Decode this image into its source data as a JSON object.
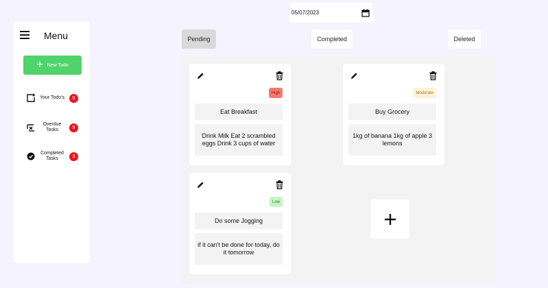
{
  "date_input": {
    "value": "05/07/2023"
  },
  "sidebar": {
    "title": "Menu",
    "new_todo_label": "New Todo",
    "items": [
      {
        "label": "Your Todo's",
        "count": "0"
      },
      {
        "label": "Overdue Tasks",
        "count": "9"
      },
      {
        "label": "Completed Tasks",
        "count": "3"
      }
    ]
  },
  "tabs": [
    {
      "label": "Pending",
      "active": true
    },
    {
      "label": "Completed",
      "active": false
    },
    {
      "label": "Deleted",
      "active": false
    }
  ],
  "todos": [
    {
      "priority": "High",
      "title": "Eat Breakfast",
      "description": "Drink Milk Eat 2 scrambled eggs Drink 3 cups of water"
    },
    {
      "priority": "Moderate",
      "title": "Buy Grocery",
      "description": "1kg of banana 1kg of apple 3 lemons"
    },
    {
      "priority": "Low",
      "title": "Do some Jogging",
      "description": "if it can't be done for today, do it tomorrow"
    }
  ],
  "colors": {
    "accent_green": "#4fd36b",
    "badge_red": "#f0141c",
    "priority_high_bg": "#f47a70",
    "priority_moderate_bg": "#fdf2d6",
    "priority_low_bg": "#c6f5c3"
  }
}
